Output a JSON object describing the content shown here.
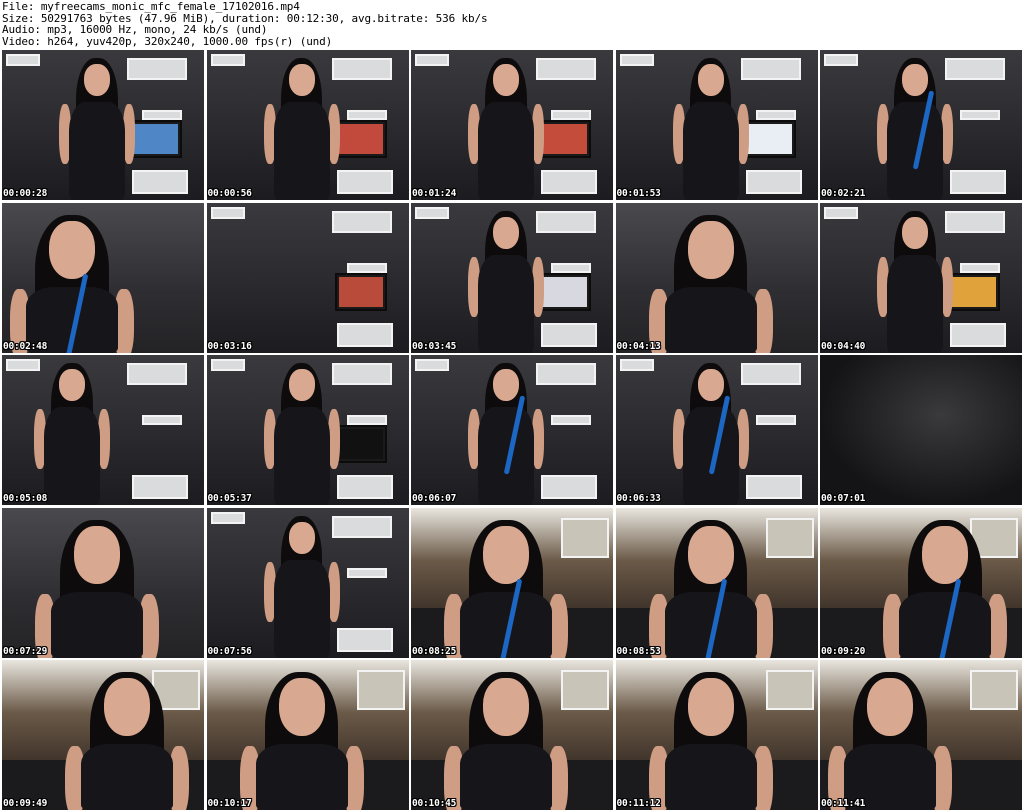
{
  "header": {
    "file_line": "File: myfreecams_monic_mfc_female_17102016.mp4",
    "size_line": "Size: 50291763 bytes (47.96 MiB), duration: 00:12:30, avg.bitrate: 536 kb/s",
    "audio_line": "Audio: mp3, 16000 Hz, mono, 24 kb/s (und)",
    "video_line": "Video: h264, yuv420p, 320x240, 1000.00 fps(r) (und)"
  },
  "thumbnails": [
    {
      "time": "00:00:28",
      "scene": "tv-room",
      "tv": true,
      "tv_color": "#4f86c6",
      "pose": "center",
      "pipe": false
    },
    {
      "time": "00:00:56",
      "scene": "tv-room",
      "tv": true,
      "tv_color": "#c24a3c",
      "pose": "center",
      "pipe": false
    },
    {
      "time": "00:01:24",
      "scene": "tv-room",
      "tv": true,
      "tv_color": "#c44c3a",
      "pose": "center",
      "pipe": false
    },
    {
      "time": "00:01:53",
      "scene": "tv-room",
      "tv": true,
      "tv_color": "#e8eef4",
      "pose": "center",
      "pipe": false
    },
    {
      "time": "00:02:21",
      "scene": "tv-room",
      "tv": false,
      "tv_color": "#222222",
      "pose": "center",
      "pipe": true
    },
    {
      "time": "00:02:48",
      "scene": "closeup",
      "tv": false,
      "tv_color": "#222222",
      "pose": "left",
      "pipe": true
    },
    {
      "time": "00:03:16",
      "scene": "tv-room",
      "tv": true,
      "tv_color": "#b84b3a",
      "pose": "none",
      "pipe": false
    },
    {
      "time": "00:03:45",
      "scene": "tv-room",
      "tv": true,
      "tv_color": "#d8d8e0",
      "pose": "center",
      "pipe": false
    },
    {
      "time": "00:04:13",
      "scene": "closeup",
      "tv": false,
      "tv_color": "#222222",
      "pose": "center",
      "pipe": false
    },
    {
      "time": "00:04:40",
      "scene": "tv-room",
      "tv": true,
      "tv_color": "#e0a23a",
      "pose": "center",
      "pipe": false
    },
    {
      "time": "00:05:08",
      "scene": "tv-room",
      "tv": false,
      "tv_color": "#222222",
      "pose": "left",
      "pipe": false
    },
    {
      "time": "00:05:37",
      "scene": "tv-room",
      "tv": true,
      "tv_color": "#111111",
      "pose": "center",
      "pipe": false
    },
    {
      "time": "00:06:07",
      "scene": "tv-room",
      "tv": false,
      "tv_color": "#222222",
      "pose": "center",
      "pipe": true
    },
    {
      "time": "00:06:33",
      "scene": "tv-room",
      "tv": false,
      "tv_color": "#222222",
      "pose": "center",
      "pipe": true
    },
    {
      "time": "00:07:01",
      "scene": "dark",
      "tv": false,
      "tv_color": "#222222",
      "pose": "none",
      "pipe": false
    },
    {
      "time": "00:07:29",
      "scene": "closeup",
      "tv": false,
      "tv_color": "#222222",
      "pose": "center",
      "pipe": false
    },
    {
      "time": "00:07:56",
      "scene": "tv-room",
      "tv": false,
      "tv_color": "#222222",
      "pose": "center",
      "pipe": false
    },
    {
      "time": "00:08:25",
      "scene": "lounge",
      "tv": false,
      "tv_color": "#222222",
      "pose": "center",
      "pipe": true
    },
    {
      "time": "00:08:53",
      "scene": "lounge",
      "tv": false,
      "tv_color": "#222222",
      "pose": "center",
      "pipe": true
    },
    {
      "time": "00:09:20",
      "scene": "lounge",
      "tv": false,
      "tv_color": "#222222",
      "pose": "right",
      "pipe": true
    },
    {
      "time": "00:09:49",
      "scene": "lounge",
      "tv": false,
      "tv_color": "#222222",
      "pose": "right",
      "pipe": false
    },
    {
      "time": "00:10:17",
      "scene": "lounge",
      "tv": false,
      "tv_color": "#222222",
      "pose": "center",
      "pipe": false
    },
    {
      "time": "00:10:45",
      "scene": "lounge",
      "tv": false,
      "tv_color": "#222222",
      "pose": "center",
      "pipe": false
    },
    {
      "time": "00:11:12",
      "scene": "lounge",
      "tv": false,
      "tv_color": "#222222",
      "pose": "center",
      "pipe": false
    },
    {
      "time": "00:11:41",
      "scene": "lounge",
      "tv": false,
      "tv_color": "#222222",
      "pose": "left",
      "pipe": false
    }
  ]
}
